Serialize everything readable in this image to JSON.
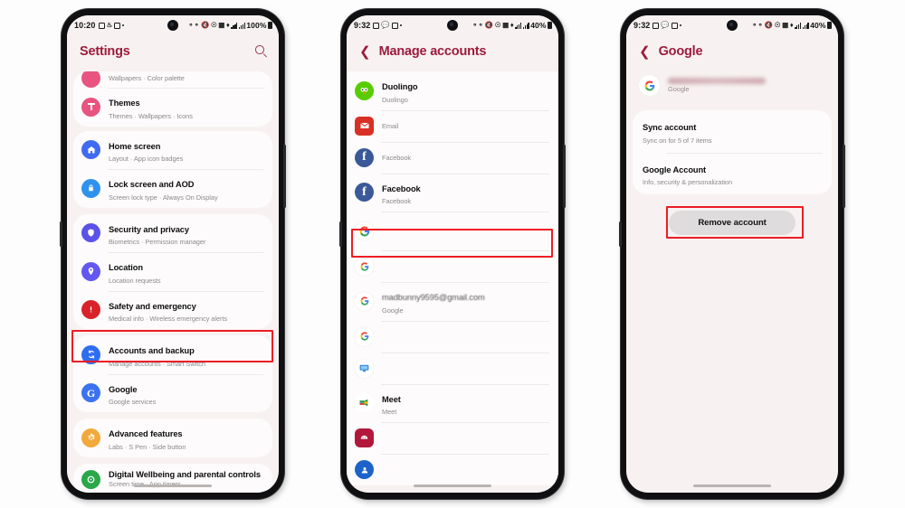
{
  "meta": {
    "accent_maroon": "#9d1b3c",
    "annotation_red": "#ee1c24",
    "screen_bg": "#f7f2f1",
    "card_bg": "#fdfbfb"
  },
  "phone1": {
    "status": {
      "clock": "10:20",
      "battery": "100%",
      "dot": "•"
    },
    "header": {
      "title": "Settings",
      "search_icon": "search-icon"
    },
    "partial_item": {
      "subtitle": "Wallpapers  ·  Color palette"
    },
    "items": [
      {
        "title": "Themes",
        "subtitle": "Themes  ·  Wallpapers  ·  Icons",
        "icon": "themes-icon",
        "color": "#e8537f",
        "glyph": "T"
      },
      {
        "title": "Home screen",
        "subtitle": "Layout  ·  App icon badges",
        "icon": "home-icon",
        "color": "#3e6bf0",
        "glyph": "H"
      },
      {
        "title": "Lock screen and AOD",
        "subtitle": "Screen lock type  ·  Always On Display",
        "icon": "lock-icon",
        "color": "#2f93ee",
        "glyph": "L"
      },
      {
        "title": "Security and privacy",
        "subtitle": "Biometrics  ·  Permission manager",
        "icon": "shield-icon",
        "color": "#5b52e8",
        "glyph": "S"
      },
      {
        "title": "Location",
        "subtitle": "Location requests",
        "icon": "location-pin-icon",
        "color": "#6257ef",
        "glyph": "P"
      },
      {
        "title": "Safety and emergency",
        "subtitle": "Medical info  ·  Wireless emergency alerts",
        "icon": "sos-icon",
        "color": "#d8232a",
        "glyph": "!"
      },
      {
        "title": "Accounts and backup",
        "subtitle": "Manage accounts  ·  Smart Switch",
        "icon": "sync-icon",
        "color": "#2f6df0",
        "glyph": "R",
        "highlighted": true
      },
      {
        "title": "Google",
        "subtitle": "Google services",
        "icon": "google-g-icon",
        "color": "#3b72f0",
        "glyph": "G"
      },
      {
        "title": "Advanced features",
        "subtitle": "Labs  ·  S Pen  ·  Side button",
        "icon": "advanced-gear-icon",
        "color": "#f2a93b",
        "glyph": "A"
      },
      {
        "title": "Digital Wellbeing and parental controls",
        "subtitle": "Screen time  ·  App timers",
        "icon": "wellbeing-icon",
        "color": "#2aa84a",
        "glyph": "W"
      }
    ]
  },
  "phone2": {
    "status": {
      "clock": "9:32",
      "battery": "40%",
      "dot": "•"
    },
    "header": {
      "title": "Manage accounts",
      "back_icon": "chevron-left-icon"
    },
    "accounts": [
      {
        "title": "Duolingo",
        "subtitle": "Duolingo",
        "icon": "duolingo-icon",
        "redacted": false
      },
      {
        "title": "",
        "subtitle": "Email",
        "icon": "email-icon",
        "redacted": true,
        "bar_width": "72%"
      },
      {
        "title": "",
        "subtitle": "Facebook",
        "icon": "facebook-icon",
        "redacted": true,
        "bar_width": "44%"
      },
      {
        "title": "Facebook",
        "subtitle": "Facebook",
        "icon": "facebook-icon",
        "redacted": false
      },
      {
        "title": "",
        "subtitle": "",
        "icon": "google-g-icon",
        "redacted": true,
        "bar_width": "60%",
        "highlighted": true
      },
      {
        "title": "",
        "subtitle": "",
        "icon": "google-g-icon",
        "redacted": true,
        "bar_width": "70%"
      },
      {
        "title": "madbunny9595@gmail.com",
        "subtitle": "Google",
        "icon": "google-g-icon",
        "redacted": false,
        "faded": true
      },
      {
        "title": "",
        "subtitle": "",
        "icon": "google-g-icon",
        "redacted": true,
        "bar_width": "72%"
      },
      {
        "title": "",
        "subtitle": "",
        "icon": "monitor-icon",
        "redacted": true,
        "bar_width": "74%"
      },
      {
        "title": "Meet",
        "subtitle": "Meet",
        "icon": "google-meet-icon",
        "redacted": false
      },
      {
        "title": "",
        "subtitle": "",
        "icon": "samsung-android-icon",
        "redacted": true,
        "bar_width": "50%"
      },
      {
        "title": "",
        "subtitle": "",
        "icon": "blue-account-icon",
        "redacted": true,
        "bar_width": "74%"
      }
    ]
  },
  "phone3": {
    "status": {
      "clock": "9:32",
      "battery": "40%",
      "dot": "•"
    },
    "header": {
      "title": "Google",
      "back_icon": "chevron-left-icon"
    },
    "account": {
      "email_redacted": true,
      "provider": "Google",
      "icon": "google-g-icon"
    },
    "items": [
      {
        "title": "Sync account",
        "subtitle": "Sync on for 5 of 7 items"
      },
      {
        "title": "Google Account",
        "subtitle": "Info, security & personalization"
      }
    ],
    "remove_button": {
      "label": "Remove account",
      "highlighted": true
    }
  }
}
